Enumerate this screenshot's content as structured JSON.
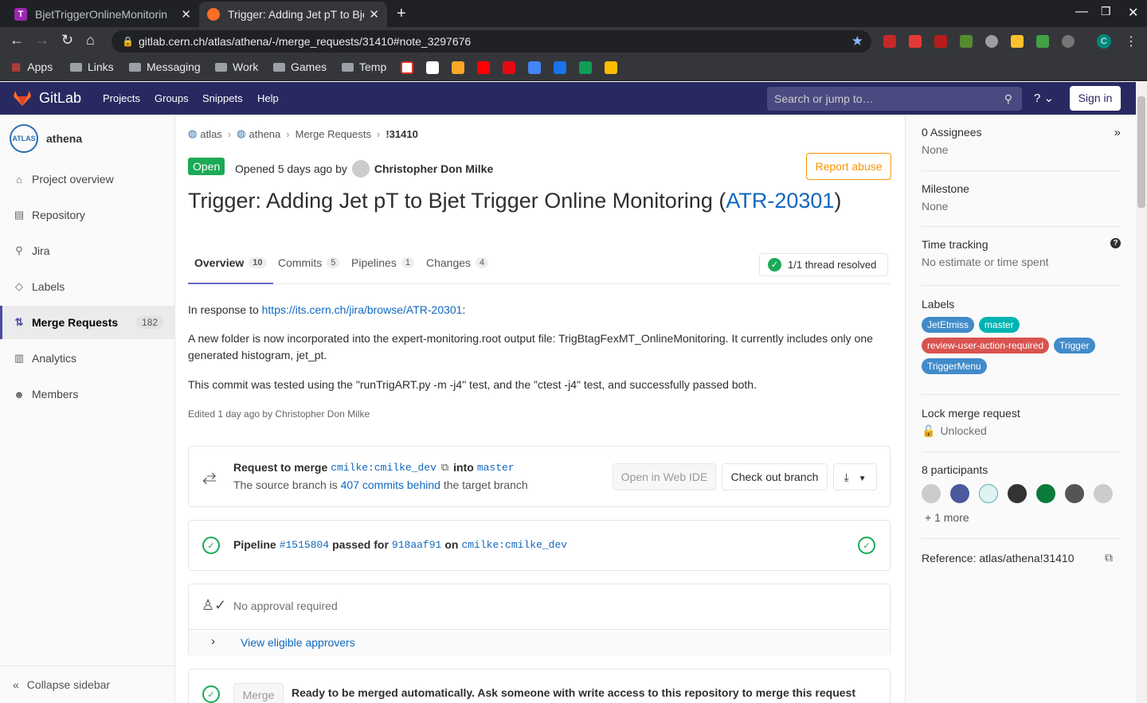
{
  "browser": {
    "tabs": [
      {
        "title": "BjetTriggerOnlineMonitorin",
        "favicon_color": "#9c27b0",
        "favicon_letter": "T"
      },
      {
        "title": "Trigger: Adding Jet pT to Bjet",
        "favicon_color": "#fc6d26",
        "favicon_letter": ""
      }
    ],
    "url": "gitlab.cern.ch/atlas/athena/-/merge_requests/31410#note_3297676",
    "bookmarks": [
      "Apps",
      "Links",
      "Messaging",
      "Work",
      "Games",
      "Temp"
    ],
    "profile_letter": "C"
  },
  "header": {
    "logo_text": "GitLab",
    "nav": [
      "Projects",
      "Groups",
      "Snippets",
      "Help"
    ],
    "search_placeholder": "Search or jump to…",
    "signin": "Sign in"
  },
  "sidebar": {
    "project_name": "athena",
    "project_avatar": "ATLAS",
    "items": [
      {
        "label": "Project overview",
        "icon": "home-icon"
      },
      {
        "label": "Repository",
        "icon": "doc-icon"
      },
      {
        "label": "Jira",
        "icon": "jira-icon"
      },
      {
        "label": "Labels",
        "icon": "label-icon"
      },
      {
        "label": "Merge Requests",
        "icon": "merge-icon",
        "count": "182"
      },
      {
        "label": "Analytics",
        "icon": "chart-icon"
      },
      {
        "label": "Members",
        "icon": "users-icon"
      }
    ],
    "collapse": "Collapse sidebar"
  },
  "breadcrumb": [
    "atlas",
    "athena",
    "Merge Requests",
    "!31410"
  ],
  "mr": {
    "status": "Open",
    "opened_text": "Opened 5 days ago by",
    "author": "Christopher Don Milke",
    "report": "Report abuse",
    "title_prefix": "Trigger: Adding Jet pT to Bjet Trigger Online Monitoring (",
    "title_link": "ATR-20301",
    "title_suffix": ")",
    "tabs": [
      {
        "label": "Overview",
        "count": "10"
      },
      {
        "label": "Commits",
        "count": "5"
      },
      {
        "label": "Pipelines",
        "count": "1"
      },
      {
        "label": "Changes",
        "count": "4"
      }
    ],
    "threads": "1/1 thread resolved",
    "desc_intro": "In response to ",
    "desc_link": "https://its.cern.ch/jira/browse/ATR-20301",
    "desc_p2": "A new folder is now incorporated into the expert-monitoring.root output file: TrigBtagFexMT_OnlineMonitoring. It currently includes only one generated histogram, jet_pt.",
    "desc_p3": "This commit was tested using the \"runTrigART.py -m -j4\" test, and the \"ctest -j4\" test, and successfully passed both.",
    "edited": "Edited 1 day ago by Christopher Don Milke"
  },
  "widget": {
    "request_label": "Request to merge",
    "source_branch": "cmilke:cmilke_dev",
    "into": "into",
    "target_branch": "master",
    "behind_prefix": "The source branch is",
    "behind_link": "407 commits behind",
    "behind_suffix": "the target branch",
    "open_ide": "Open in Web IDE",
    "checkout": "Check out branch",
    "pipeline_label": "Pipeline",
    "pipeline_id": "#1515804",
    "pipeline_passed": "passed for",
    "commit": "918aaf91",
    "on": "on",
    "approval": "No approval required",
    "view_approvers": "View eligible approvers",
    "merge_btn": "Merge",
    "merge_text": "Ready to be merged automatically. Ask someone with write access to this repository to merge this request"
  },
  "rsidebar": {
    "assignees_title": "0 Assignees",
    "assignees_val": "None",
    "milestone_title": "Milestone",
    "milestone_val": "None",
    "time_title": "Time tracking",
    "time_val": "No estimate or time spent",
    "labels_title": "Labels",
    "labels": [
      {
        "name": "JetEtmiss",
        "color": "#428bca"
      },
      {
        "name": "master",
        "color": "#00b3b3"
      },
      {
        "name": "review-user-action-required",
        "color": "#d9534f"
      },
      {
        "name": "Trigger",
        "color": "#428bca"
      },
      {
        "name": "TriggerMenu",
        "color": "#428bca"
      }
    ],
    "lock_title": "Lock merge request",
    "lock_val": "Unlocked",
    "participants_title": "8 participants",
    "more": "+ 1 more",
    "reference": "Reference: atlas/athena!31410"
  }
}
